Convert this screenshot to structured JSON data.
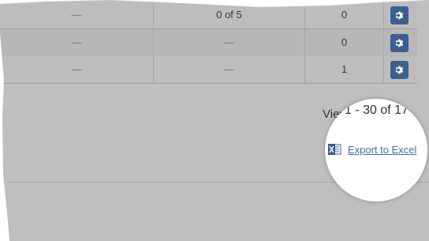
{
  "rows": [
    {
      "col1": "—",
      "col2": "0 of 5",
      "col3": "0"
    },
    {
      "col1": "—",
      "col2": "—",
      "col3": "0"
    },
    {
      "col1": "—",
      "col2": "—",
      "col3": "1"
    }
  ],
  "pagination": {
    "left_fragment": "Viev",
    "zoomed_text": "1 - 30 of 17"
  },
  "export": {
    "label": "Export to Excel",
    "icon": "excel-icon"
  },
  "settings_icon": "gear-icon",
  "colors": {
    "gear_button": "#3e5f92",
    "link": "#3b73a8"
  }
}
